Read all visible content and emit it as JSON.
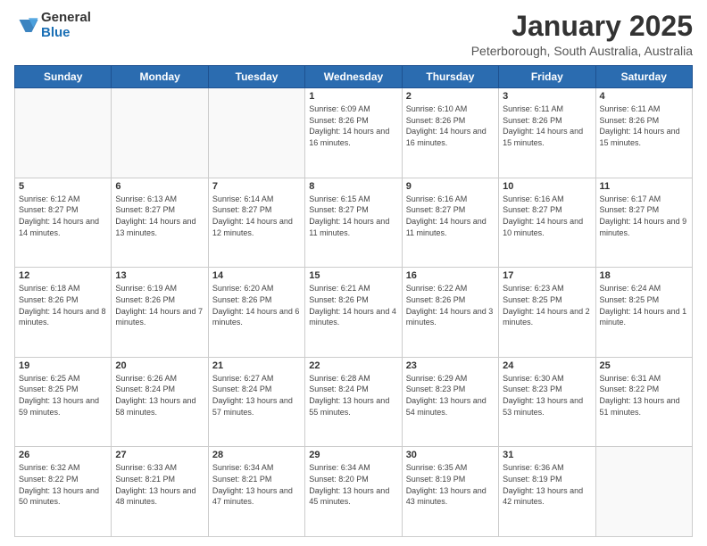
{
  "logo": {
    "general": "General",
    "blue": "Blue"
  },
  "header": {
    "month": "January 2025",
    "location": "Peterborough, South Australia, Australia"
  },
  "weekdays": [
    "Sunday",
    "Monday",
    "Tuesday",
    "Wednesday",
    "Thursday",
    "Friday",
    "Saturday"
  ],
  "weeks": [
    [
      {
        "day": "",
        "sunrise": "",
        "sunset": "",
        "daylight": ""
      },
      {
        "day": "",
        "sunrise": "",
        "sunset": "",
        "daylight": ""
      },
      {
        "day": "",
        "sunrise": "",
        "sunset": "",
        "daylight": ""
      },
      {
        "day": "1",
        "sunrise": "Sunrise: 6:09 AM",
        "sunset": "Sunset: 8:26 PM",
        "daylight": "Daylight: 14 hours and 16 minutes."
      },
      {
        "day": "2",
        "sunrise": "Sunrise: 6:10 AM",
        "sunset": "Sunset: 8:26 PM",
        "daylight": "Daylight: 14 hours and 16 minutes."
      },
      {
        "day": "3",
        "sunrise": "Sunrise: 6:11 AM",
        "sunset": "Sunset: 8:26 PM",
        "daylight": "Daylight: 14 hours and 15 minutes."
      },
      {
        "day": "4",
        "sunrise": "Sunrise: 6:11 AM",
        "sunset": "Sunset: 8:26 PM",
        "daylight": "Daylight: 14 hours and 15 minutes."
      }
    ],
    [
      {
        "day": "5",
        "sunrise": "Sunrise: 6:12 AM",
        "sunset": "Sunset: 8:27 PM",
        "daylight": "Daylight: 14 hours and 14 minutes."
      },
      {
        "day": "6",
        "sunrise": "Sunrise: 6:13 AM",
        "sunset": "Sunset: 8:27 PM",
        "daylight": "Daylight: 14 hours and 13 minutes."
      },
      {
        "day": "7",
        "sunrise": "Sunrise: 6:14 AM",
        "sunset": "Sunset: 8:27 PM",
        "daylight": "Daylight: 14 hours and 12 minutes."
      },
      {
        "day": "8",
        "sunrise": "Sunrise: 6:15 AM",
        "sunset": "Sunset: 8:27 PM",
        "daylight": "Daylight: 14 hours and 11 minutes."
      },
      {
        "day": "9",
        "sunrise": "Sunrise: 6:16 AM",
        "sunset": "Sunset: 8:27 PM",
        "daylight": "Daylight: 14 hours and 11 minutes."
      },
      {
        "day": "10",
        "sunrise": "Sunrise: 6:16 AM",
        "sunset": "Sunset: 8:27 PM",
        "daylight": "Daylight: 14 hours and 10 minutes."
      },
      {
        "day": "11",
        "sunrise": "Sunrise: 6:17 AM",
        "sunset": "Sunset: 8:27 PM",
        "daylight": "Daylight: 14 hours and 9 minutes."
      }
    ],
    [
      {
        "day": "12",
        "sunrise": "Sunrise: 6:18 AM",
        "sunset": "Sunset: 8:26 PM",
        "daylight": "Daylight: 14 hours and 8 minutes."
      },
      {
        "day": "13",
        "sunrise": "Sunrise: 6:19 AM",
        "sunset": "Sunset: 8:26 PM",
        "daylight": "Daylight: 14 hours and 7 minutes."
      },
      {
        "day": "14",
        "sunrise": "Sunrise: 6:20 AM",
        "sunset": "Sunset: 8:26 PM",
        "daylight": "Daylight: 14 hours and 6 minutes."
      },
      {
        "day": "15",
        "sunrise": "Sunrise: 6:21 AM",
        "sunset": "Sunset: 8:26 PM",
        "daylight": "Daylight: 14 hours and 4 minutes."
      },
      {
        "day": "16",
        "sunrise": "Sunrise: 6:22 AM",
        "sunset": "Sunset: 8:26 PM",
        "daylight": "Daylight: 14 hours and 3 minutes."
      },
      {
        "day": "17",
        "sunrise": "Sunrise: 6:23 AM",
        "sunset": "Sunset: 8:25 PM",
        "daylight": "Daylight: 14 hours and 2 minutes."
      },
      {
        "day": "18",
        "sunrise": "Sunrise: 6:24 AM",
        "sunset": "Sunset: 8:25 PM",
        "daylight": "Daylight: 14 hours and 1 minute."
      }
    ],
    [
      {
        "day": "19",
        "sunrise": "Sunrise: 6:25 AM",
        "sunset": "Sunset: 8:25 PM",
        "daylight": "Daylight: 13 hours and 59 minutes."
      },
      {
        "day": "20",
        "sunrise": "Sunrise: 6:26 AM",
        "sunset": "Sunset: 8:24 PM",
        "daylight": "Daylight: 13 hours and 58 minutes."
      },
      {
        "day": "21",
        "sunrise": "Sunrise: 6:27 AM",
        "sunset": "Sunset: 8:24 PM",
        "daylight": "Daylight: 13 hours and 57 minutes."
      },
      {
        "day": "22",
        "sunrise": "Sunrise: 6:28 AM",
        "sunset": "Sunset: 8:24 PM",
        "daylight": "Daylight: 13 hours and 55 minutes."
      },
      {
        "day": "23",
        "sunrise": "Sunrise: 6:29 AM",
        "sunset": "Sunset: 8:23 PM",
        "daylight": "Daylight: 13 hours and 54 minutes."
      },
      {
        "day": "24",
        "sunrise": "Sunrise: 6:30 AM",
        "sunset": "Sunset: 8:23 PM",
        "daylight": "Daylight: 13 hours and 53 minutes."
      },
      {
        "day": "25",
        "sunrise": "Sunrise: 6:31 AM",
        "sunset": "Sunset: 8:22 PM",
        "daylight": "Daylight: 13 hours and 51 minutes."
      }
    ],
    [
      {
        "day": "26",
        "sunrise": "Sunrise: 6:32 AM",
        "sunset": "Sunset: 8:22 PM",
        "daylight": "Daylight: 13 hours and 50 minutes."
      },
      {
        "day": "27",
        "sunrise": "Sunrise: 6:33 AM",
        "sunset": "Sunset: 8:21 PM",
        "daylight": "Daylight: 13 hours and 48 minutes."
      },
      {
        "day": "28",
        "sunrise": "Sunrise: 6:34 AM",
        "sunset": "Sunset: 8:21 PM",
        "daylight": "Daylight: 13 hours and 47 minutes."
      },
      {
        "day": "29",
        "sunrise": "Sunrise: 6:34 AM",
        "sunset": "Sunset: 8:20 PM",
        "daylight": "Daylight: 13 hours and 45 minutes."
      },
      {
        "day": "30",
        "sunrise": "Sunrise: 6:35 AM",
        "sunset": "Sunset: 8:19 PM",
        "daylight": "Daylight: 13 hours and 43 minutes."
      },
      {
        "day": "31",
        "sunrise": "Sunrise: 6:36 AM",
        "sunset": "Sunset: 8:19 PM",
        "daylight": "Daylight: 13 hours and 42 minutes."
      },
      {
        "day": "",
        "sunrise": "",
        "sunset": "",
        "daylight": ""
      }
    ]
  ]
}
